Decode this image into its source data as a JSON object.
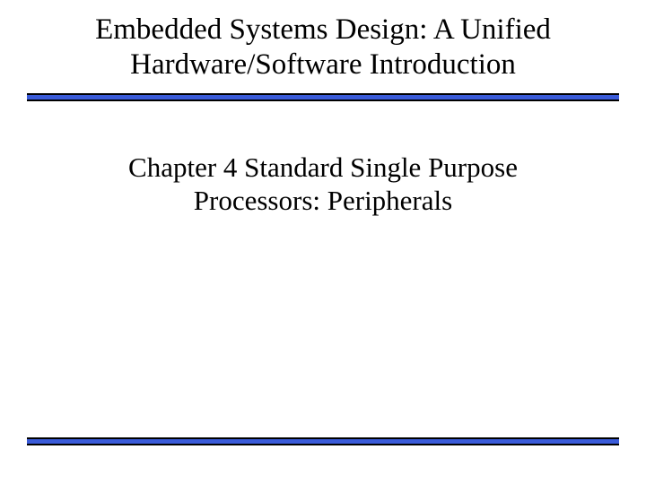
{
  "title_line1": "Embedded Systems Design: A Unified",
  "title_line2": "Hardware/Software Introduction",
  "subtitle_line1": "Chapter 4 Standard Single Purpose",
  "subtitle_line2": "Processors: Peripherals",
  "colors": {
    "rule_fill": "#3a5bd9",
    "rule_border": "#000000",
    "text": "#000000",
    "background": "#ffffff"
  }
}
